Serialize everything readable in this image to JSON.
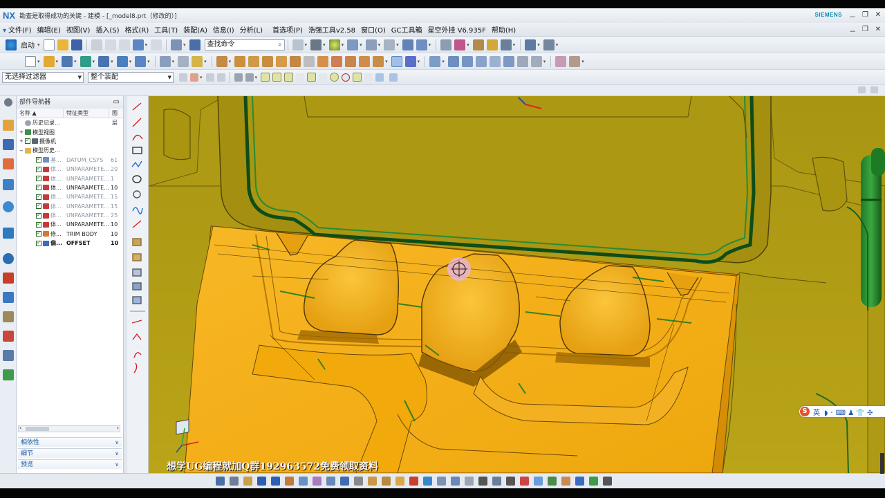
{
  "window": {
    "logo": "NX",
    "title": "勘查是取得成功的关键 - 建模 - [_model8.prt（修改的）]",
    "brand": "SIEMENS",
    "controls": [
      "－",
      "❐",
      "✕"
    ],
    "doc_controls": [
      "－",
      "❐",
      "✕"
    ]
  },
  "menu": {
    "items": [
      "文件(F)",
      "编辑(E)",
      "视图(V)",
      "插入(S)",
      "格式(R)",
      "工具(T)",
      "装配(A)",
      "信息(I)",
      "分析(L)",
      "首选项(P)",
      "浩强工具v2.58",
      "窗口(O)",
      "GC工具箱",
      "星空外挂 V6.935F",
      "帮助(H)"
    ]
  },
  "toolbar": {
    "start_label": "启动",
    "search_placeholder": "查找命令",
    "filter_value": "无选择过滤器",
    "scope_value": "整个装配"
  },
  "navigator": {
    "title": "部件导航器",
    "columns": [
      "名称",
      "特征类型",
      "图层"
    ],
    "nodes": [
      {
        "name": "历史记录...",
        "type": "",
        "layer": "",
        "style": "normal"
      },
      {
        "name": "模型视图",
        "type": "",
        "layer": "",
        "style": "normal"
      },
      {
        "name": "摄像机",
        "type": "",
        "layer": "",
        "style": "normal"
      },
      {
        "name": "模型历史...",
        "type": "",
        "layer": "",
        "style": "normal"
      }
    ],
    "features": [
      {
        "name": "基...",
        "type": "DATUM_CSYS",
        "layer": "61",
        "style": "gray"
      },
      {
        "name": "体...",
        "type": "UNPARAMETE...",
        "layer": "20",
        "style": "gray"
      },
      {
        "name": "体...",
        "type": "UNPARAMETE...",
        "layer": "1",
        "style": "gray"
      },
      {
        "name": "体...",
        "type": "UNPARAMETE...",
        "layer": "10",
        "style": "normal"
      },
      {
        "name": "体...",
        "type": "UNPARAMETE...",
        "layer": "15",
        "style": "gray"
      },
      {
        "name": "体...",
        "type": "UNPARAMETE...",
        "layer": "15",
        "style": "gray"
      },
      {
        "name": "体...",
        "type": "UNPARAMETE...",
        "layer": "25",
        "style": "gray"
      },
      {
        "name": "体...",
        "type": "UNPARAMETE...",
        "layer": "10",
        "style": "normal"
      },
      {
        "name": "修...",
        "type": "TRIM BODY",
        "layer": "10",
        "style": "normal"
      },
      {
        "name": "偏...",
        "type": "OFFSET",
        "layer": "10",
        "style": "bold"
      }
    ],
    "panels": [
      "相依性",
      "细节",
      "预览"
    ]
  },
  "graphics": {
    "watermark": "想学UG编程就加Q群192963572免费领取资料",
    "ime_lang": "英",
    "ime_tools": "◗ ･ ⌨ ♟ 👕 ✣",
    "colors": {
      "part": "#f2ae12",
      "pocket_floor": "#efa800",
      "background": "#b5a114",
      "green_edge": "#1a7a2a"
    }
  }
}
